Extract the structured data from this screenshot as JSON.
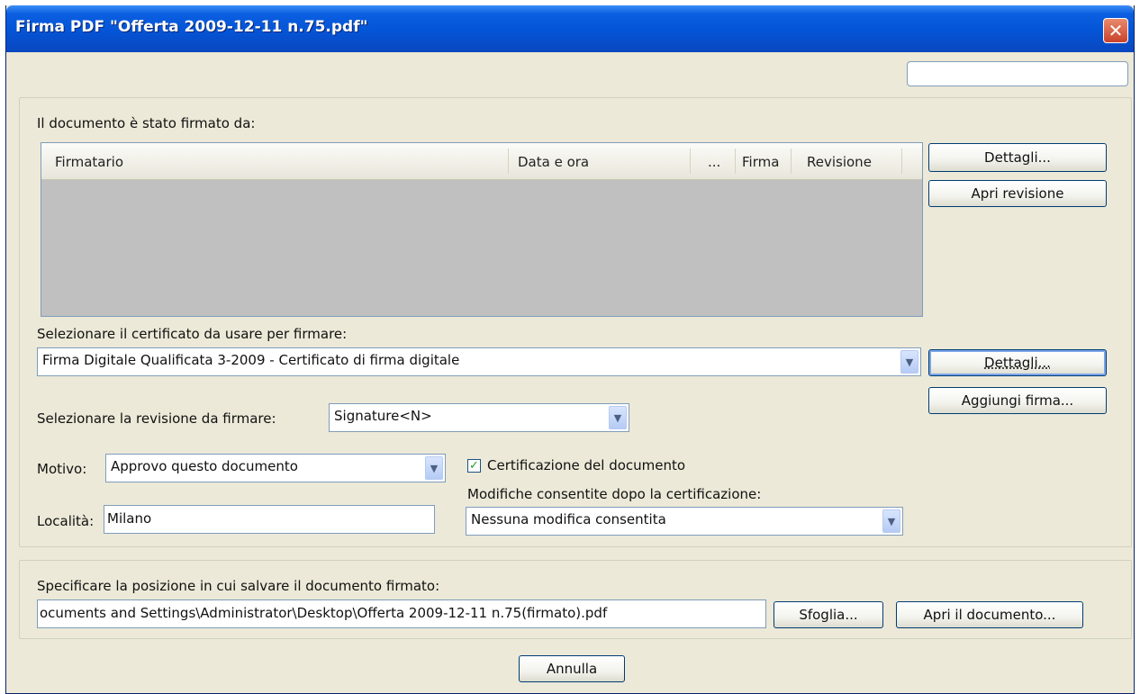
{
  "window": {
    "title": "Firma PDF \"Offerta 2009-12-11 n.75.pdf\"",
    "close_glyph": "✕"
  },
  "signed_section": {
    "label": "Il documento è stato firmato da:",
    "columns": [
      "Firmatario",
      "Data e ora",
      "...",
      "Firma",
      "Revisione"
    ],
    "rows": [],
    "details_button": "Dettagli...",
    "open_revision_button": "Apri revisione"
  },
  "certificate": {
    "label": "Selezionare il certificato da usare per firmare:",
    "selected": "Firma Digitale Qualificata 3-2009 - Certificato di firma digitale",
    "details_button": "Dettagli...",
    "add_signature_button": "Aggiungi firma..."
  },
  "revision": {
    "label": "Selezionare la revisione da firmare:",
    "selected": "Signature<N>"
  },
  "reason": {
    "label": "Motivo:",
    "selected": "Approvo questo documento"
  },
  "location": {
    "label": "Località:",
    "value": "Milano"
  },
  "certification": {
    "checkbox_label": "Certificazione del documento",
    "checked": true,
    "changes_label": "Modifiche consentite dopo la certificazione:",
    "changes_selected": "Nessuna modifica consentita"
  },
  "save": {
    "label": "Specificare la posizione in cui salvare il documento firmato:",
    "path": "ocuments and Settings\\Administrator\\Desktop\\Offerta 2009-12-11 n.75(firmato).pdf",
    "browse_button": "Sfoglia...",
    "open_doc_button": "Apri il documento..."
  },
  "cancel_button": "Annulla",
  "colors": {
    "titlebar": "#0454d6",
    "dialog_bg": "#ece9d8",
    "table_bg": "#c0c0c0",
    "checkmark": "#21a121"
  }
}
